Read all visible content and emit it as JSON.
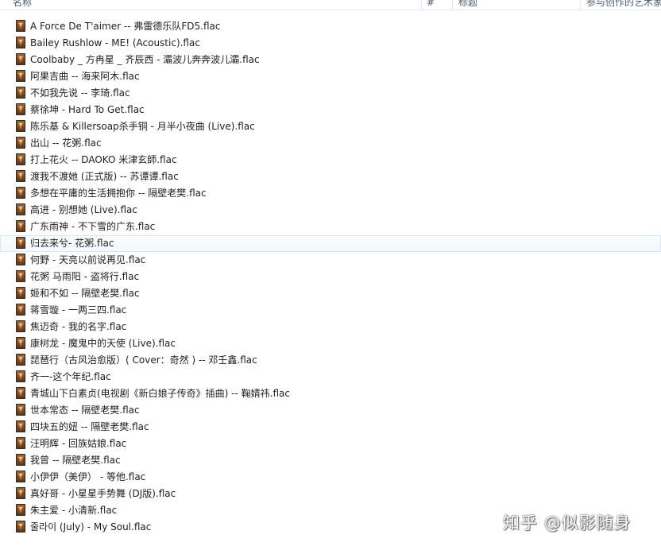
{
  "columns": {
    "name": "名称",
    "number": "#",
    "title": "标题",
    "artists": "参与创作的艺术家"
  },
  "icon": "flac-file-icon",
  "hover_index": 13,
  "files": [
    "A Force De T'aimer -- 弗雷德乐队FD5.flac",
    "Bailey Rushlow - ME! (Acoustic).flac",
    "Coolbaby _ 方冉星 _ 齐辰西 - 灞波儿奔奔波儿灞.flac",
    "阿果吉曲 -- 海来阿木.flac",
    "不如我先说 -- 李琦.flac",
    "蔡徐坤 - Hard To Get.flac",
    "陈乐基 & Killersoap杀手铜 - 月半小夜曲 (Live).flac",
    "出山 -- 花粥.flac",
    "打上花火 -- DAOKO 米津玄師.flac",
    "渡我不渡她 (正式版) -- 苏谭谭.flac",
    "多想在平庸的生活拥抱你 -- 隔壁老樊.flac",
    "高进 - 别想她 (Live).flac",
    "广东雨神 - 不下雪的广东.flac",
    "归去来兮- 花粥.flac",
    "何野 - 天亮以前说再见.flac",
    "花粥 马雨阳 - 盗将行.flac",
    "姬和不如 -- 隔壁老樊.flac",
    "蒋雪璇 - 一两三四.flac",
    "焦迈奇 - 我的名字.flac",
    "康树龙 - 魔鬼中的天使 (Live).flac",
    "琵琶行（古风治愈版）( Cover：奇然 ) -- 邓壬鑫.flac",
    "齐一-这个年纪.flac",
    "青城山下白素贞(电视剧《新白娘子传奇》插曲) -- 鞠婧祎.flac",
    "世本常态 -- 隔壁老樊.flac",
    "四块五的妞 -- 隔壁老樊.flac",
    "汪明辉 - 回族姑娘.flac",
    "我曾 -- 隔壁老樊.flac",
    "小伊伊（美伊） - 等他.flac",
    "真好哥 - 小星星手势舞 (DJ版).flac",
    "朱主爱 - 小清新.flac",
    "줄라이 (July) - My Soul.flac"
  ],
  "watermark": "知乎 @似影随身"
}
